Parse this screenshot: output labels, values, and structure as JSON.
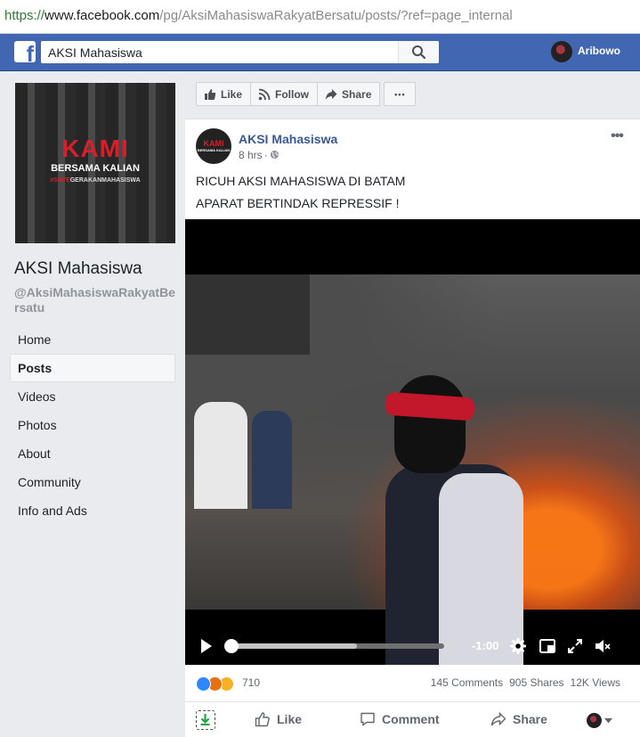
{
  "browser": {
    "url_protocol": "https://",
    "url_host": "www.facebook.com",
    "url_path": "/pg/AksiMahasiswaRakyatBersatu/posts/?ref=page_internal"
  },
  "topbar": {
    "search_value": "AKSI Mahasiswa",
    "user_name": "Aribowo",
    "brand_color": "#4267b2"
  },
  "page": {
    "cover_title": "KAMI",
    "cover_subtitle": "BERSAMA KALIAN",
    "cover_tag_highlight": "#SAVE",
    "cover_tag_rest": "GERAKANMAHASISWA",
    "name": "AKSI Mahasiswa",
    "handle": "@AksiMahasiswaRakyatBersatu",
    "nav": [
      {
        "label": "Home",
        "active": false
      },
      {
        "label": "Posts",
        "active": true
      },
      {
        "label": "Videos",
        "active": false
      },
      {
        "label": "Photos",
        "active": false
      },
      {
        "label": "About",
        "active": false
      },
      {
        "label": "Community",
        "active": false
      },
      {
        "label": "Info and Ads",
        "active": false
      }
    ]
  },
  "page_actions": {
    "like": "Like",
    "follow": "Follow",
    "share": "Share",
    "more": "•••"
  },
  "post": {
    "author": "AKSI Mahasiswa",
    "time": "8 hrs",
    "menu": "•••",
    "line1": "RICUH AKSI MAHASISWA DI BATAM",
    "line2": "APARAT BERTINDAK REPRESSIF !",
    "video": {
      "time_remaining": "-1:00",
      "played_fraction": 0.0,
      "buffered_fraction": 0.6
    },
    "reactions_count": "710",
    "comments": "145 Comments",
    "shares": "905 Shares",
    "views": "12K Views",
    "actions": {
      "like": "Like",
      "comment": "Comment",
      "share": "Share"
    }
  }
}
